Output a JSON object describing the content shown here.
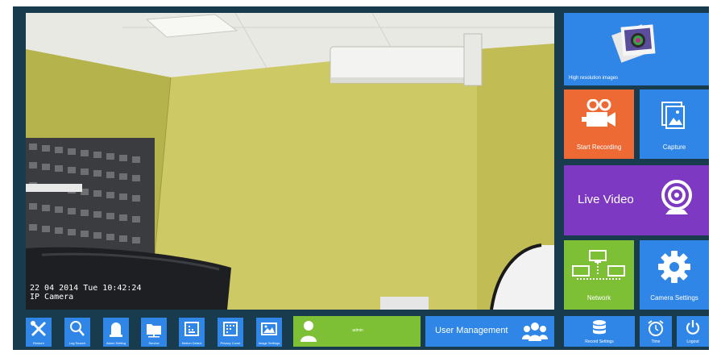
{
  "camera": {
    "osd_datetime": "22 04 2014 Tue 10:42:24",
    "osd_name": "IP Camera"
  },
  "tiles": {
    "high_res": "High resolution images",
    "start_recording": "Start Recording",
    "capture": "Capture",
    "live_video": "Live Video",
    "network": "Network",
    "camera_settings": "Camera Settings"
  },
  "toolbar": {
    "restore": "Restore",
    "log_search": "Log Search",
    "alarm_setting": "Alarm Setting",
    "service": "Service",
    "motion_detect": "Motion Detect",
    "privacy_cover": "Privacy Cover",
    "image_settings": "Image Settings",
    "user_name": "admin",
    "user_management": "User Management",
    "record_settings": "Record Settings",
    "time": "Time",
    "logout": "Logout"
  },
  "colors": {
    "frame": "#183c4e",
    "tile_blue": "#2f86e6",
    "tile_orange": "#ee6a35",
    "tile_purple": "#7d39c2",
    "tile_green": "#7ec035"
  }
}
